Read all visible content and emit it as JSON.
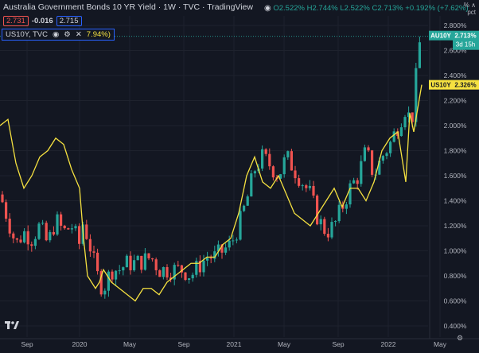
{
  "header": {
    "title": "Australia Government Bonds 10 YR Yield · 1W · TVC · TradingView",
    "open": "O2.522%",
    "high": "H2.744%",
    "low": "L2.522%",
    "close": "C2.713%",
    "change": "+0.192% (+7.62%)"
  },
  "price_row": {
    "bid": "2.731",
    "spread": "-0.016",
    "ask": "2.715"
  },
  "compare": {
    "symbol": "US10Y, TVC",
    "pct": "7.94%)"
  },
  "scale": {
    "top": "% ∧",
    "unit": "pct"
  },
  "y_axis": [
    "2.800%",
    "2.600%",
    "2.400%",
    "2.200%",
    "2.000%",
    "1.800%",
    "1.600%",
    "1.400%",
    "1.200%",
    "1.000%",
    "0.800%",
    "0.600%",
    "0.400%"
  ],
  "x_axis": [
    "Sep",
    "2020",
    "May",
    "Sep",
    "2021",
    "May",
    "Sep",
    "2022",
    "May"
  ],
  "tags": {
    "au": {
      "label": "AU10Y",
      "value": "2.713%",
      "timer": "3d 15h"
    },
    "us": {
      "label": "US10Y",
      "value": "2.326%"
    }
  },
  "colors": {
    "up": "#26a69a",
    "down": "#ef5350",
    "compare": "#f5e140",
    "bg": "#131722"
  },
  "chart_data": {
    "type": "line",
    "series": [
      {
        "name": "AU10Y",
        "x": [
          0,
          10,
          20,
          30,
          40,
          50,
          60,
          70,
          80,
          90,
          100,
          105,
          110,
          115,
          120,
          125,
          130,
          140,
          150,
          160,
          170,
          180,
          190,
          200,
          210,
          220,
          230,
          240,
          250,
          260,
          270,
          280,
          290,
          300,
          310,
          320,
          330,
          340,
          350,
          360,
          370,
          380,
          390,
          400,
          410,
          420,
          430,
          440,
          450,
          460,
          470,
          480,
          490,
          500,
          510,
          515,
          520,
          525,
          530
        ],
        "values": [
          1.45,
          1.25,
          1.05,
          1.15,
          1.1,
          1.2,
          1.05,
          1.25,
          1.15,
          1.2,
          1.05,
          1.25,
          1.1,
          1.0,
          0.85,
          0.75,
          0.7,
          0.85,
          0.85,
          0.9,
          0.9,
          0.92,
          0.95,
          0.85,
          0.85,
          0.85,
          0.85,
          0.8,
          0.88,
          0.95,
          0.95,
          1.0,
          1.05,
          1.2,
          1.4,
          1.65,
          1.75,
          1.68,
          1.6,
          1.75,
          1.65,
          1.55,
          1.45,
          1.25,
          1.15,
          1.2,
          1.35,
          1.5,
          1.6,
          1.8,
          1.6,
          1.75,
          1.85,
          2.0,
          2.15,
          2.05,
          2.1,
          2.6,
          2.713
        ]
      },
      {
        "name": "US10Y",
        "x": [
          0,
          10,
          20,
          30,
          40,
          50,
          60,
          70,
          80,
          90,
          100,
          105,
          110,
          120,
          125,
          130,
          140,
          150,
          160,
          170,
          180,
          190,
          200,
          210,
          220,
          230,
          240,
          250,
          260,
          270,
          280,
          290,
          300,
          310,
          320,
          330,
          340,
          350,
          360,
          370,
          380,
          390,
          400,
          410,
          420,
          430,
          440,
          450,
          460,
          470,
          480,
          490,
          500,
          510,
          515,
          520,
          530
        ],
        "values": [
          2.0,
          2.05,
          1.7,
          1.5,
          1.6,
          1.75,
          1.8,
          1.9,
          1.85,
          1.65,
          1.5,
          1.1,
          0.8,
          0.7,
          0.75,
          0.85,
          0.75,
          0.7,
          0.65,
          0.6,
          0.7,
          0.7,
          0.65,
          0.75,
          0.8,
          0.85,
          0.9,
          0.9,
          0.95,
          0.95,
          1.05,
          1.1,
          1.3,
          1.6,
          1.75,
          1.55,
          1.5,
          1.6,
          1.45,
          1.3,
          1.25,
          1.2,
          1.3,
          1.4,
          1.5,
          1.35,
          1.5,
          1.5,
          1.4,
          1.55,
          1.8,
          1.9,
          1.95,
          1.55,
          2.1,
          1.95,
          2.326
        ]
      }
    ],
    "ylim": [
      0.4,
      2.8
    ],
    "xlabel": "",
    "ylabel": ""
  }
}
